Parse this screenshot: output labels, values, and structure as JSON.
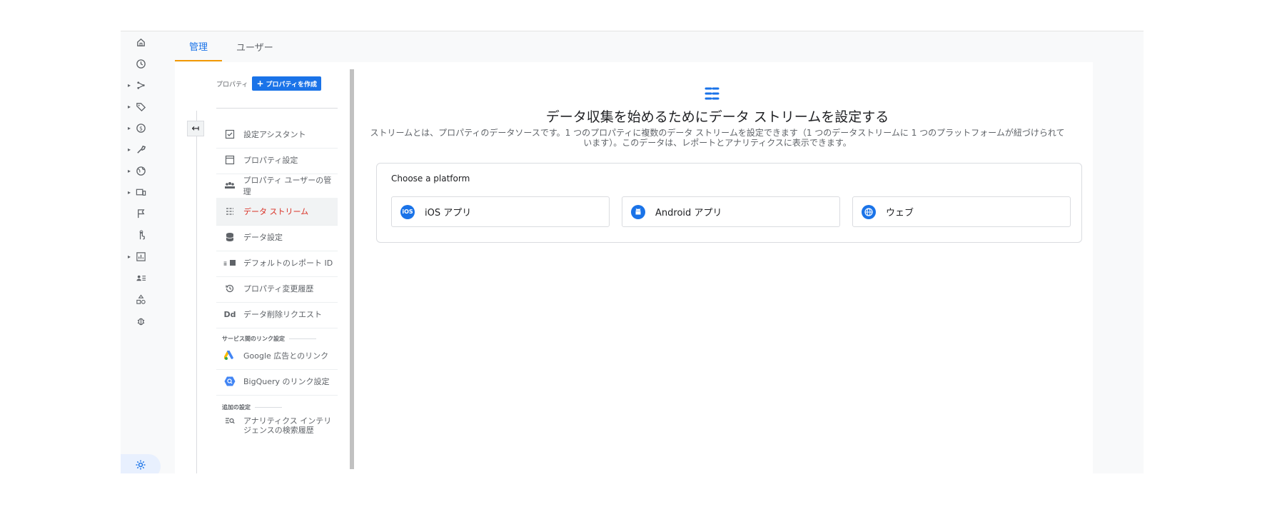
{
  "tabs": [
    {
      "label": "管理",
      "active": true
    },
    {
      "label": "ユーザー",
      "active": false
    }
  ],
  "rail": {
    "icons": [
      "home-icon",
      "clock-icon",
      "explore-icon",
      "tag-icon",
      "dollar-icon",
      "wrench-icon",
      "globe-icon",
      "devices-icon",
      "flag-icon",
      "touch-icon",
      "report-icon",
      "audience-icon",
      "shapes-icon",
      "debug-icon"
    ],
    "settings_icon": "gear-icon"
  },
  "property": {
    "label": "プロパティ",
    "create_button": "プロパティを作成"
  },
  "nav": {
    "items": [
      {
        "label": "設定アシスタント",
        "icon": "checklist-icon",
        "active": false
      },
      {
        "label": "プロパティ設定",
        "icon": "property-settings-icon",
        "active": false
      },
      {
        "label": "プロパティ ユーザーの管理",
        "icon": "users-icon",
        "active": false
      },
      {
        "label": "データ ストリーム",
        "icon": "data-stream-icon",
        "active": true
      },
      {
        "label": "データ設定",
        "icon": "database-icon",
        "active": false
      },
      {
        "label": "デフォルトのレポート ID",
        "icon": "reporting-id-icon",
        "active": false
      },
      {
        "label": "プロパティ変更履歴",
        "icon": "history-icon",
        "active": false
      },
      {
        "label": "データ削除リクエスト",
        "icon": "data-deletion-icon",
        "active": false
      }
    ],
    "section_links": "サービス間のリンク設定",
    "links": [
      {
        "label": "Google 広告とのリンク",
        "icon": "google-ads-icon"
      },
      {
        "label": "BigQuery のリンク設定",
        "icon": "bigquery-icon"
      }
    ],
    "section_extra": "追加の設定",
    "extra_item": "アナリティクス インテリジェンスの検索履歴"
  },
  "main": {
    "title": "データ収集を始めるためにデータ ストリームを設定する",
    "description": "ストリームとは、プロパティのデータソースです。1 つのプロパティに複数のデータ ストリームを設定できます（1 つのデータストリームに 1 つのプラットフォームが紐づけられています）。このデータは、レポートとアナリティクスに表示できます。",
    "choose_label": "Choose a platform",
    "platforms": [
      {
        "label": "iOS アプリ",
        "icon": "ios-icon",
        "badge": "iOS"
      },
      {
        "label": "Android アプリ",
        "icon": "android-icon",
        "badge": ""
      },
      {
        "label": "ウェブ",
        "icon": "web-globe-icon",
        "badge": ""
      }
    ]
  },
  "colors": {
    "accent": "#1a73e8",
    "active_nav": "#d93025",
    "tab_indicator": "#f29900"
  }
}
